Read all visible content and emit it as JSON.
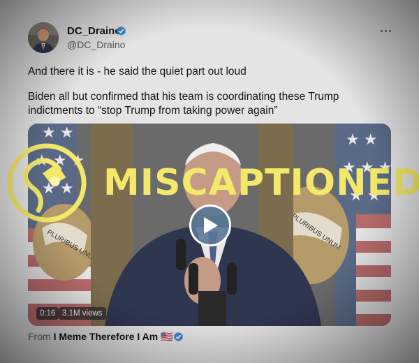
{
  "author": {
    "name": "DC_Draino",
    "handle": "@DC_Draino",
    "verified_icon": "verified-badge-icon"
  },
  "tweet": {
    "line1": "And there it is - he said the quiet part out loud",
    "line2": "Biden all but confirmed that his team is coordinating these Trump",
    "line3": "indictments to “stop Trump from taking power again”"
  },
  "video": {
    "duration": "0:16",
    "views": "3.1M views",
    "seal_text": "PLURIBUS UNUM"
  },
  "source": {
    "prefix": "From",
    "account": "I Meme Therefore I Am",
    "flag": "🇺🇸"
  },
  "overlay": {
    "label": "MISCAPTIONED",
    "color": "#f3e86a"
  }
}
